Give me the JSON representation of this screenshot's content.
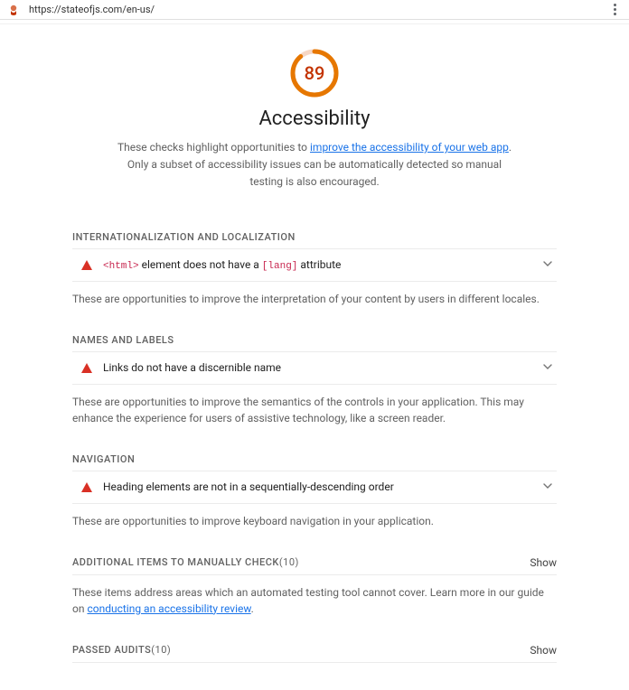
{
  "browser": {
    "url": "https://stateofjs.com/en-us/"
  },
  "gauge": {
    "score": "89",
    "title": "Accessibility"
  },
  "intro": {
    "pre": "These checks highlight opportunities to ",
    "link1": "improve the accessibility of your web app",
    "mid": ". Only a subset of accessibility issues can be automatically detected so manual testing is also encouraged."
  },
  "sections": {
    "intl": {
      "header": "INTERNATIONALIZATION AND LOCALIZATION",
      "audit_pre": "<html>",
      "audit_mid": " element does not have a ",
      "audit_code": "[lang]",
      "audit_post": " attribute",
      "desc": "These are opportunities to improve the interpretation of your content by users in different locales."
    },
    "names": {
      "header": "NAMES AND LABELS",
      "audit": "Links do not have a discernible name",
      "desc": "These are opportunities to improve the semantics of the controls in your application. This may enhance the experience for users of assistive technology, like a screen reader."
    },
    "nav": {
      "header": "NAVIGATION",
      "audit": "Heading elements are not in a sequentially-descending order",
      "desc": "These are opportunities to improve keyboard navigation in your application."
    },
    "manual": {
      "header": "ADDITIONAL ITEMS TO MANUALLY CHECK",
      "count": " (10)",
      "show": "Show",
      "desc_pre": "These items address areas which an automated testing tool cannot cover. Learn more in our guide on ",
      "desc_link": "conducting an accessibility review",
      "desc_post": "."
    },
    "passed": {
      "header": "PASSED AUDITS",
      "count": " (10)",
      "show": "Show"
    }
  }
}
